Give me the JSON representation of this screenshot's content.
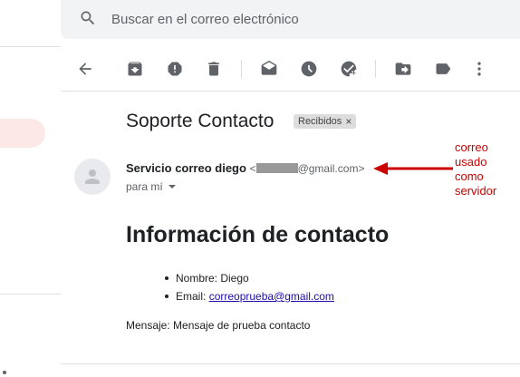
{
  "search": {
    "placeholder": "Buscar en el correo electrónico"
  },
  "toolbar": {
    "icons": [
      "back-arrow-icon",
      "archive-icon",
      "report-spam-icon",
      "delete-icon",
      "mark-unread-icon",
      "snooze-icon",
      "add-to-tasks-icon",
      "move-to-icon",
      "label-icon",
      "more-icon"
    ]
  },
  "email": {
    "subject": "Soporte Contacto",
    "label": "Recibidos",
    "label_close": "×",
    "sender_name": "Servicio correo diego",
    "sender_email_prefix": "<",
    "sender_email_suffix": "@gmail.com>",
    "to": "para mí"
  },
  "annotation": {
    "lines": [
      "correo",
      "usado",
      "como",
      "servidor"
    ],
    "color": "#cc0000"
  },
  "body": {
    "title": "Información de contacto",
    "name_label": "Nombre: Diego",
    "email_label": "Email: ",
    "email_link": "correoprueba@gmail.com",
    "message": "Mensaje: Mensaje de prueba contacto"
  },
  "colors": {
    "search_bg": "#f1f3f4",
    "active_nav": "#fce8e6",
    "link": "#1a0dab",
    "icon": "#5f6368"
  }
}
